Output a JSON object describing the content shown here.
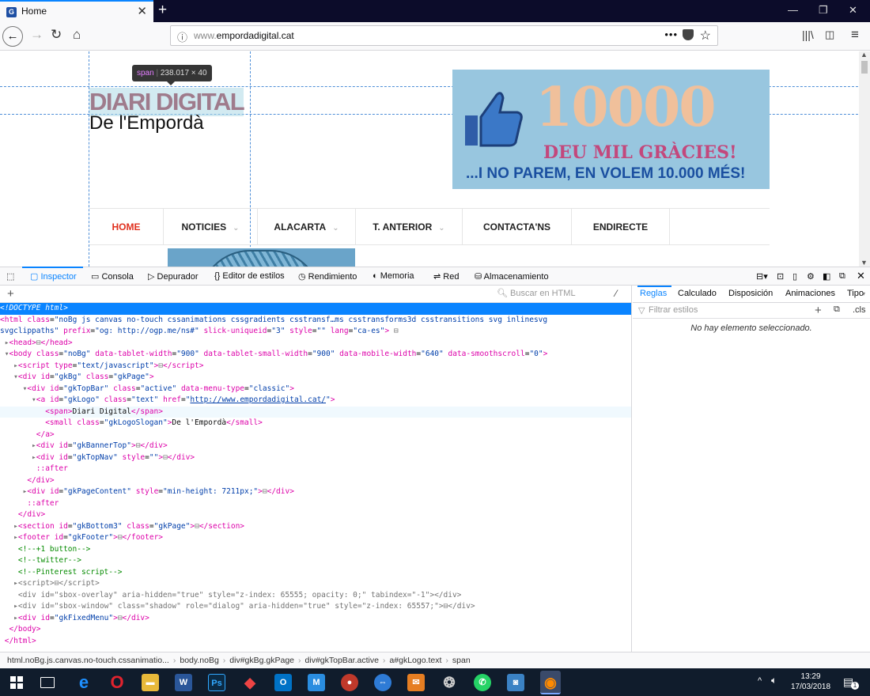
{
  "browser": {
    "tab_title": "Home",
    "url_domain": "www.",
    "url_host": "empordadigital.cat",
    "window_controls": [
      "—",
      "❐",
      "✕"
    ]
  },
  "page": {
    "logo_title": "DIARI DIGITAL",
    "logo_slogan": "De l'Empordà",
    "tooltip_tag": "span",
    "tooltip_size": "238.017 × 40",
    "banner": {
      "big_number": "10000",
      "thanks": "DEU MIL GRÀCIES!",
      "tagline": "...I NO PAREM, EN VOLEM 10.000 MÉS!"
    },
    "menu": [
      {
        "label": "HOME",
        "chevron": false,
        "active": true
      },
      {
        "label": "NOTICIES",
        "chevron": true,
        "active": false
      },
      {
        "label": "ALACARTA",
        "chevron": true,
        "active": false
      },
      {
        "label": "T. ANTERIOR",
        "chevron": true,
        "active": false
      },
      {
        "label": "CONTACTA'NS",
        "chevron": false,
        "active": false
      },
      {
        "label": "ENDIRECTE",
        "chevron": false,
        "active": false
      }
    ]
  },
  "devtools": {
    "tools": [
      "Inspector",
      "Consola",
      "Depurador",
      "Editor de estilos",
      "Rendimiento",
      "Memoria",
      "Red",
      "Almacenamiento"
    ],
    "search_placeholder": "Buscar en HTML",
    "rules_tabs": [
      "Reglas",
      "Calculado",
      "Disposición",
      "Animaciones",
      "Tipo"
    ],
    "filter_placeholder": "Filtrar estilos",
    "cls_label": ".cls",
    "empty_message": "No hay elemento seleccionado.",
    "breadcrumbs": [
      "html.noBg.js.canvas.no-touch.cssanimatio...",
      "body.noBg",
      "div#gkBg.gkPage",
      "div#gkTopBar.active",
      "a#gkLogo.text",
      "span"
    ]
  },
  "taskbar": {
    "time": "13:29",
    "date": "17/03/2018",
    "notifications": "1"
  },
  "colors": {
    "accent": "#0a84ff",
    "menu_active": "#e0301e",
    "tabstrip": "#0c0c2a",
    "taskbar": "#101c2c"
  }
}
